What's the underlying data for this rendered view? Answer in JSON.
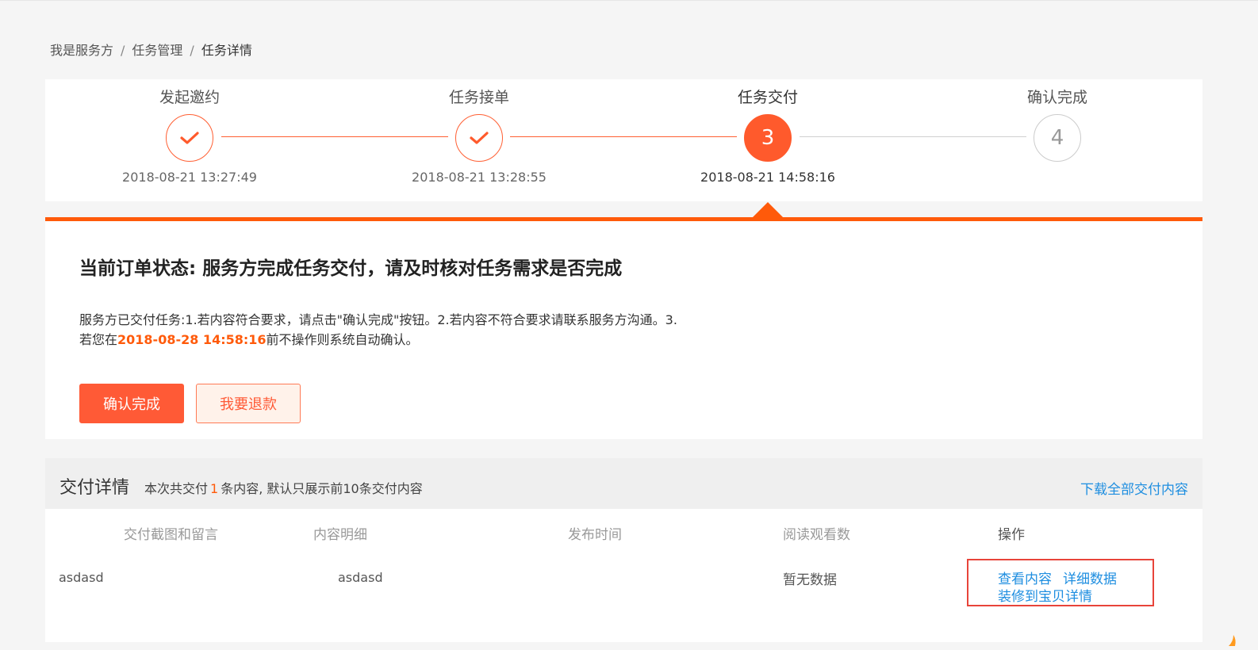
{
  "breadcrumb": [
    "我是服务方",
    "任务管理",
    "任务详情"
  ],
  "breadcrumb_sep": "/",
  "steps": [
    {
      "title": "发起邀约",
      "status": "done",
      "time": "2018-08-21 13:27:49",
      "number": ""
    },
    {
      "title": "任务接单",
      "status": "done",
      "time": "2018-08-21 13:28:55",
      "number": ""
    },
    {
      "title": "任务交付",
      "status": "active",
      "time": "2018-08-21 14:58:16",
      "number": "3"
    },
    {
      "title": "确认完成",
      "status": "todo",
      "time": "",
      "number": "4"
    }
  ],
  "status": {
    "title": "当前订单状态: 服务方完成任务交付，请及时核对任务需求是否完成",
    "desc_part1": "服务方已交付任务:1.若内容符合要求，请点击\"确认完成\"按钮。2.若内容不符合要求请联系服务方沟通。3.",
    "desc_part2_prefix": "若您在",
    "deadline": "2018-08-28 14:58:16",
    "desc_part2_suffix": "前不操作则系统自动确认。",
    "confirm_button": "确认完成",
    "refund_button": "我要退款"
  },
  "delivery": {
    "title": "交付详情",
    "summary_prefix": "本次共交付",
    "count": "1",
    "summary_suffix": "条内容, 默认只展示前10条交付内容",
    "download_link": "下载全部交付内容",
    "columns": [
      "交付截图和留言",
      "内容明细",
      "发布时间",
      "阅读观看数",
      "操作"
    ],
    "rows": [
      {
        "screenshot_note": "asdasd",
        "content_detail": "asdasd",
        "publish_time": "",
        "views": "暂无数据",
        "actions": [
          "查看内容",
          "详细数据",
          "装修到宝贝详情"
        ]
      }
    ]
  },
  "colors": {
    "accent": "#ff5a36",
    "progress_line": "#ff5a0a",
    "link": "#1e8ee0",
    "highlight_box": "#e8443a"
  }
}
